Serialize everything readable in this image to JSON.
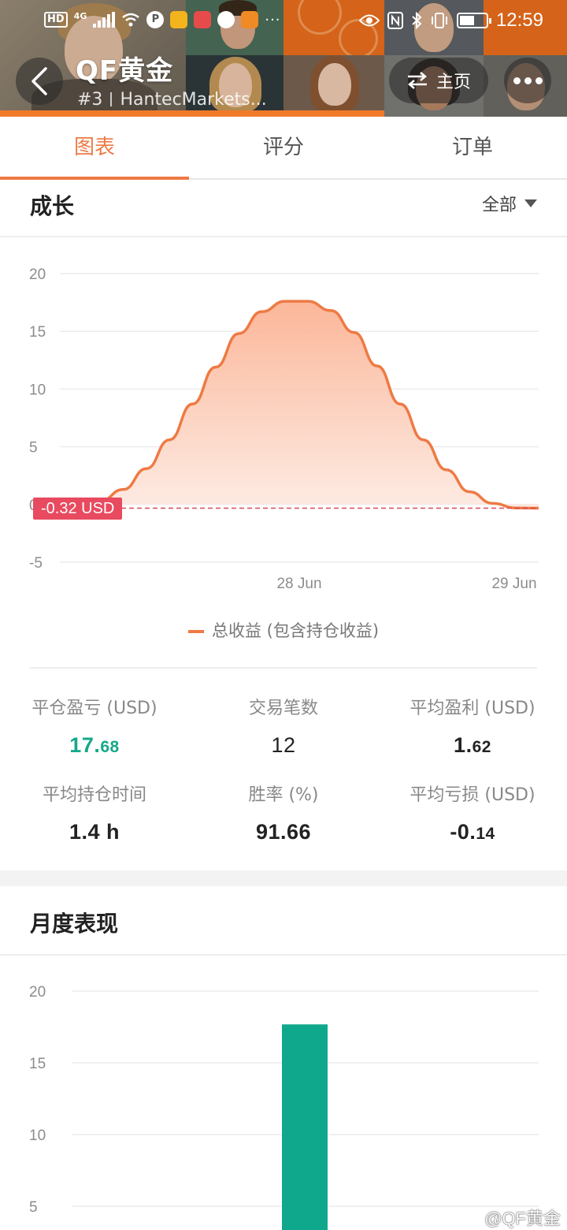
{
  "status_bar": {
    "hd": "HD",
    "network": "4G",
    "time": "12:59",
    "battery_level": 0.55
  },
  "header": {
    "title": "QF黄金",
    "rank": "#3",
    "broker": "HantecMarkets...",
    "home_label": "主页",
    "accent": "#f07a2a"
  },
  "tabs": [
    {
      "label": "图表",
      "active": true
    },
    {
      "label": "评分",
      "active": false
    },
    {
      "label": "订单",
      "active": false
    }
  ],
  "growth": {
    "title": "成长",
    "filter_label": "全部",
    "current_value_tag": "-0.32 USD",
    "legend_label": "总收益 (包含持仓收益)",
    "line_color": "#ee7a44"
  },
  "chart_data": [
    {
      "type": "area",
      "y_ticks": [
        "20",
        "15",
        "10",
        "5",
        "0",
        "-5"
      ],
      "x_ticks": [
        "28 Jun",
        "29 Jun"
      ],
      "ylim": [
        -5,
        20
      ],
      "x": [
        0,
        0.05,
        0.1,
        0.15,
        0.2,
        0.25,
        0.3,
        0.35,
        0.4,
        0.45,
        0.5,
        0.55,
        0.6,
        0.65,
        0.7,
        0.75,
        0.8,
        0.85,
        0.9,
        0.95,
        1.0
      ],
      "values": [
        0,
        0.3,
        1.3,
        3.1,
        5.6,
        8.7,
        11.9,
        14.8,
        16.7,
        17.6,
        17.6,
        16.8,
        14.9,
        12.0,
        8.7,
        5.6,
        3.0,
        1.1,
        0.1,
        -0.3,
        -0.32
      ],
      "series": [
        {
          "name": "总收益 (包含持仓收益)"
        }
      ],
      "reference_line": -0.32,
      "grid": true
    },
    {
      "type": "bar",
      "y_ticks": [
        "20",
        "15",
        "10",
        "5"
      ],
      "ylim": [
        0,
        20
      ],
      "values": [
        17.68
      ],
      "grid": true
    }
  ],
  "stats": [
    {
      "label": "平仓盈亏 (USD)",
      "value_main": "17.",
      "value_small": "68",
      "style": "green"
    },
    {
      "label": "交易笔数",
      "value_main": "12",
      "value_small": "",
      "style": "plain"
    },
    {
      "label": "平均盈利 (USD)",
      "value_main": "1.",
      "value_small": "62",
      "style": "dark"
    },
    {
      "label": "平均持仓时间",
      "value_main": "1.4 h",
      "value_small": "",
      "style": "dark"
    },
    {
      "label": "胜率 (%)",
      "value_main": "91.66",
      "value_small": "",
      "style": "dark"
    },
    {
      "label": "平均亏损 (USD)",
      "value_main": "-0.",
      "value_small": "14",
      "style": "dark"
    }
  ],
  "monthly": {
    "title": "月度表现",
    "bar_color": "#10a88c"
  },
  "watermark": "@QF黄金"
}
